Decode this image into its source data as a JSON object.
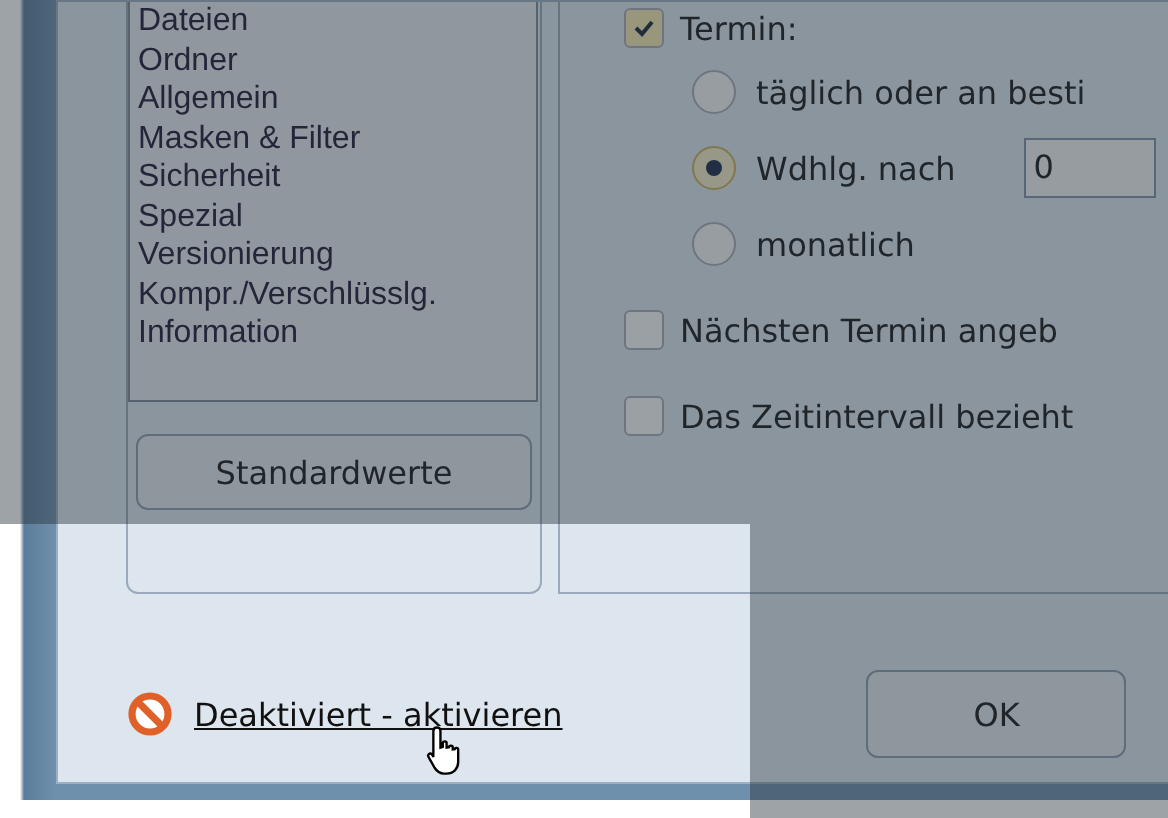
{
  "categories": [
    {
      "label": "Dateien"
    },
    {
      "label": "Ordner"
    },
    {
      "label": "Allgemein"
    },
    {
      "label": "Masken & Filter"
    },
    {
      "label": "Sicherheit"
    },
    {
      "label": "Spezial"
    },
    {
      "label": "Versionierung"
    },
    {
      "label": "Kompr./Verschlüsslg."
    },
    {
      "label": "Information"
    }
  ],
  "defaults_button": "Standardwerte",
  "schedule": {
    "label": "Termin:",
    "checked": true,
    "options": [
      {
        "label": "täglich oder an besti",
        "selected": false
      },
      {
        "label": "Wdhlg. nach",
        "selected": true,
        "value": "0"
      },
      {
        "label": "monatlich",
        "selected": false
      }
    ]
  },
  "checkboxes": [
    {
      "label": "Nächsten Termin angeb",
      "checked": false
    },
    {
      "label": "Das Zeitintervall bezieht",
      "checked": false
    }
  ],
  "status_link": "Deaktiviert - aktivieren",
  "ok_button": "OK"
}
